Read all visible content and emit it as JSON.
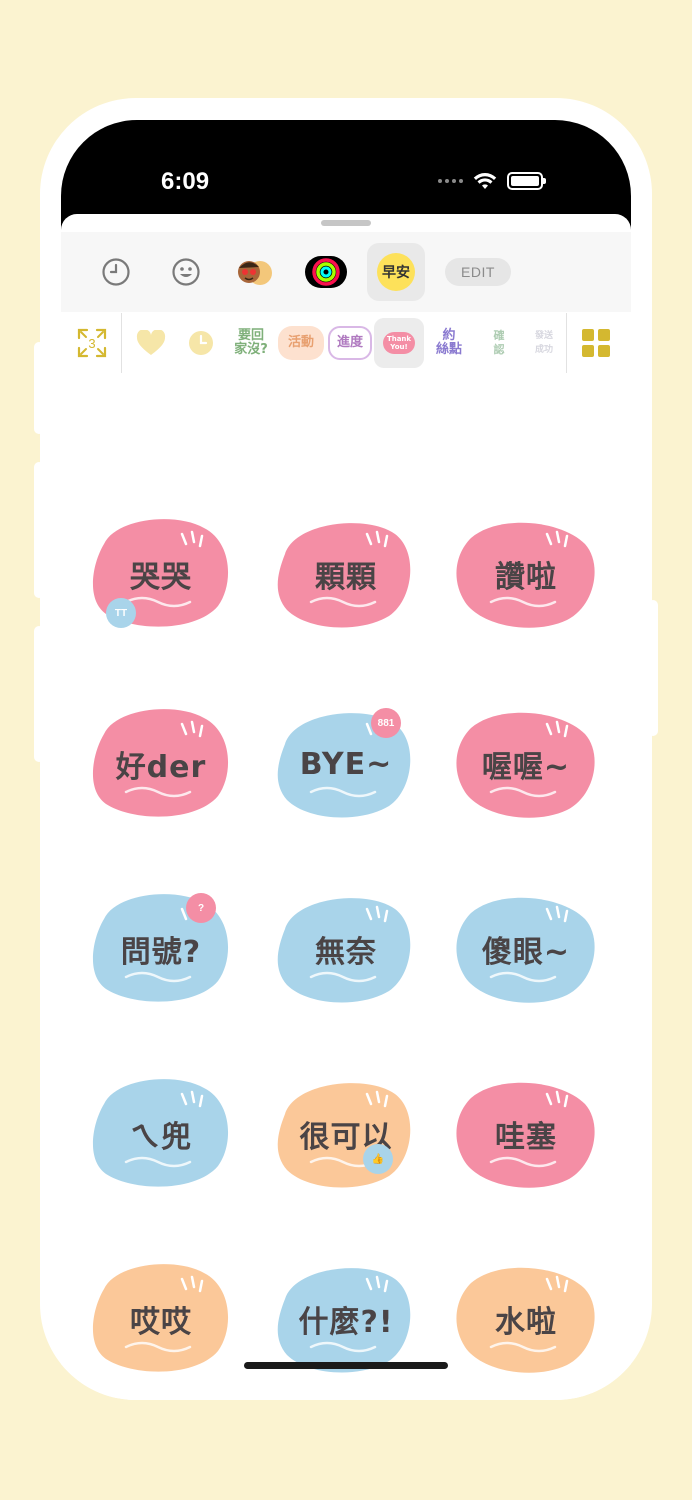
{
  "status_bar": {
    "time": "6:09"
  },
  "app_row": {
    "items": [
      "recent-icon",
      "emoji-icon",
      "memoji-icon",
      "activity-rings-icon",
      "sticker-app-icon"
    ],
    "selected_app_text": "早安",
    "edit_label": "EDIT"
  },
  "pack_row": {
    "packs": [
      {
        "text": "要回\n家沒?",
        "color": "#7fb07a"
      },
      {
        "text": "活動",
        "color": "#e8a070"
      },
      {
        "text": "進度",
        "color": "#b07ac0"
      },
      {
        "text": "Thank\nYou!",
        "color": "#e87a9a"
      },
      {
        "text": "約\n絲點",
        "color": "#8a7ad0"
      },
      {
        "text": "確\n認",
        "color": "#9ac0a0"
      },
      {
        "text": "發送\n成功",
        "color": "#b0b0c0"
      }
    ]
  },
  "stickers": [
    {
      "label": "哭哭",
      "color": "#f48ea5",
      "badge": "TT",
      "badge_color": "#a9d4ea"
    },
    {
      "label": "顆顆",
      "color": "#f48ea5",
      "badge": "",
      "badge_color": ""
    },
    {
      "label": "讚啦",
      "color": "#f48ea5",
      "badge": "",
      "badge_color": ""
    },
    {
      "label": "好der",
      "color": "#f48ea5",
      "badge": "",
      "badge_color": ""
    },
    {
      "label": "BYE~",
      "color": "#a9d4ea",
      "badge": "881",
      "badge_color": "#f48ea5"
    },
    {
      "label": "喔喔~",
      "color": "#f48ea5",
      "badge": "",
      "badge_color": ""
    },
    {
      "label": "問號?",
      "color": "#a9d4ea",
      "badge": "?",
      "badge_color": "#f48ea5"
    },
    {
      "label": "無奈",
      "color": "#a9d4ea",
      "badge": "",
      "badge_color": ""
    },
    {
      "label": "傻眼~",
      "color": "#a9d4ea",
      "badge": "",
      "badge_color": ""
    },
    {
      "label": "ㄟ兜",
      "color": "#a9d4ea",
      "badge": "",
      "badge_color": ""
    },
    {
      "label": "很可以",
      "color": "#fbc899",
      "badge": "👍",
      "badge_color": "#a9d4ea"
    },
    {
      "label": "哇塞",
      "color": "#f48ea5",
      "badge": "",
      "badge_color": ""
    },
    {
      "label": "哎哎",
      "color": "#fbc899",
      "badge": "",
      "badge_color": ""
    },
    {
      "label": "什麼?!",
      "color": "#a9d4ea",
      "badge": "",
      "badge_color": ""
    },
    {
      "label": "水啦",
      "color": "#fbc899",
      "badge": "",
      "badge_color": ""
    }
  ],
  "colors": {
    "background": "#fbf3d0",
    "accent_gold": "#d4b830"
  }
}
